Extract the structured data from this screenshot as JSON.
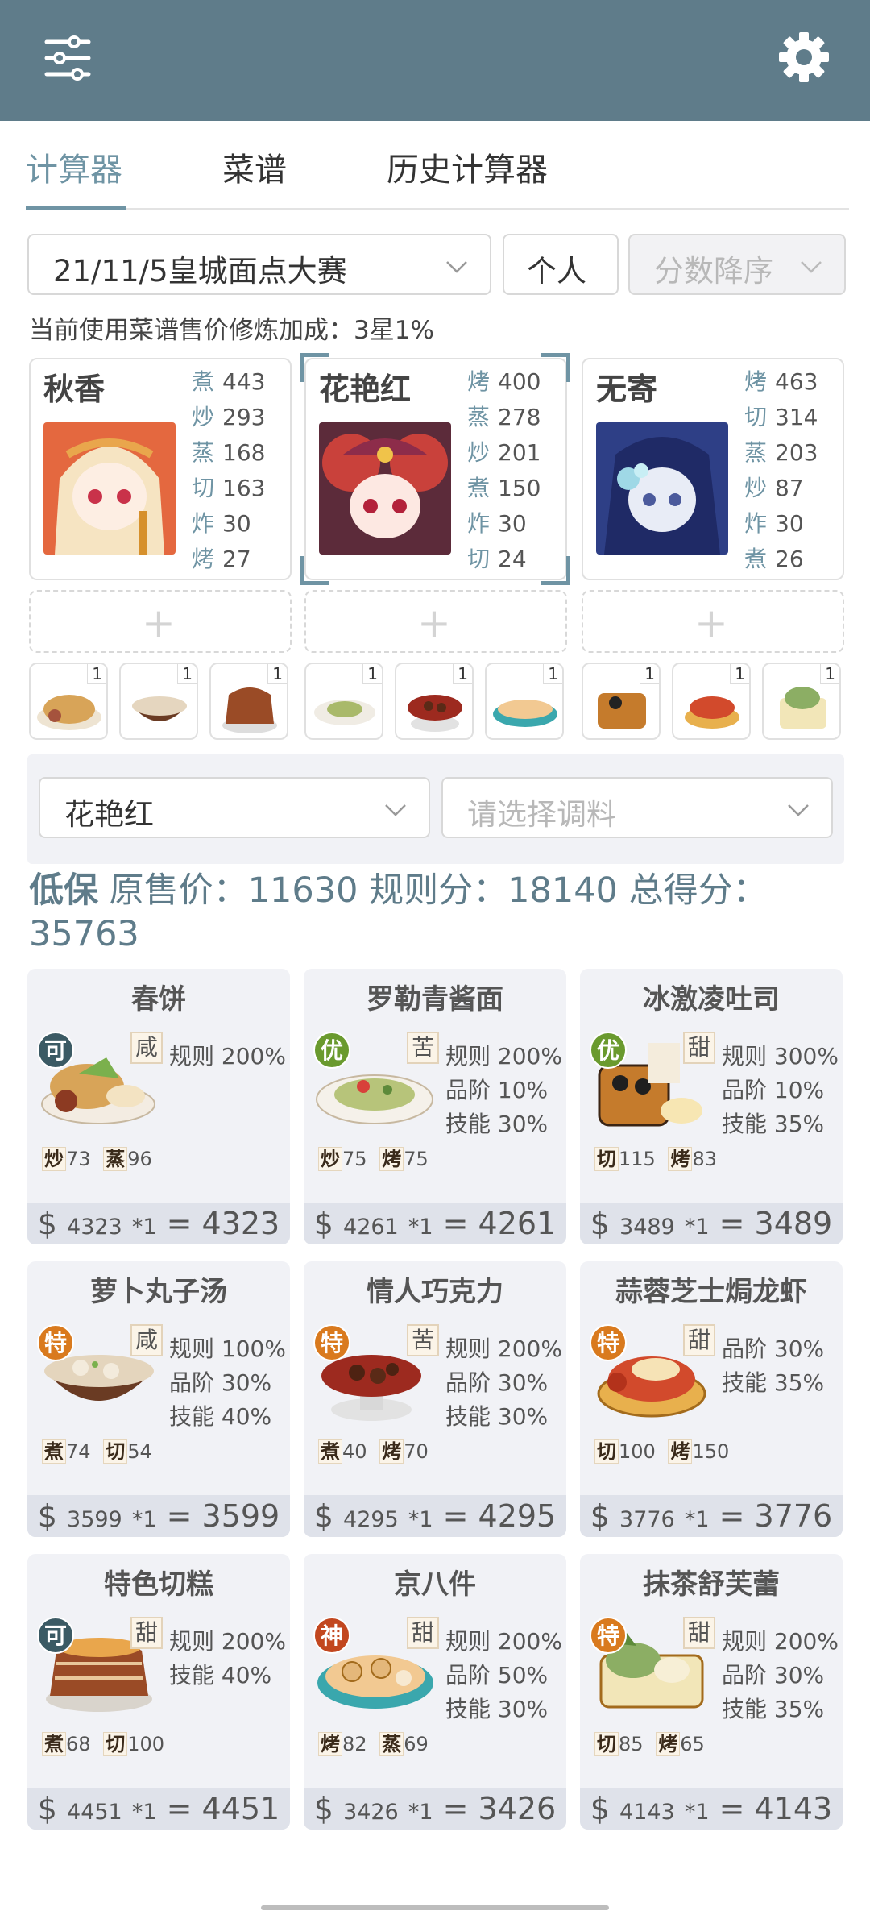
{
  "appbar": {
    "menu_icon": "sliders-icon",
    "settings_icon": "gear-icon",
    "color": "#5f7c8a"
  },
  "tabs": [
    {
      "label": "计算器",
      "active": true
    },
    {
      "label": "菜谱"
    },
    {
      "label": "历史计算器"
    }
  ],
  "filters": {
    "event": "21/11/5皇城面点大赛",
    "mode": "个人",
    "sort_placeholder": "分数降序"
  },
  "note": "当前使用菜谱售价修炼加成：3星1%",
  "chefs": [
    {
      "name": "秋香",
      "stats": [
        [
          "煮",
          "443"
        ],
        [
          "炒",
          "293"
        ],
        [
          "蒸",
          "168"
        ],
        [
          "切",
          "163"
        ],
        [
          "炸",
          "30"
        ],
        [
          "烤",
          "27"
        ]
      ]
    },
    {
      "name": "花艳红",
      "selected": true,
      "stats": [
        [
          "烤",
          "400"
        ],
        [
          "蒸",
          "278"
        ],
        [
          "炒",
          "201"
        ],
        [
          "煮",
          "150"
        ],
        [
          "炸",
          "30"
        ],
        [
          "切",
          "24"
        ]
      ]
    },
    {
      "name": "无寄",
      "stats": [
        [
          "烤",
          "463"
        ],
        [
          "切",
          "314"
        ],
        [
          "蒸",
          "203"
        ],
        [
          "炒",
          "87"
        ],
        [
          "炸",
          "30"
        ],
        [
          "煮",
          "26"
        ]
      ]
    }
  ],
  "add_label": "+",
  "dish_slot_count": "1",
  "chef_select": "花艳红",
  "seasoning_placeholder": "请选择调料",
  "summary": {
    "low": "低保",
    "text": " 原售价：11630 规则分：18140 总得分：",
    "total": "35763"
  },
  "dishes": [
    {
      "name": "春饼",
      "grade": "可",
      "grade_color": "#3b5a64",
      "taste": "咸",
      "rules": [
        "规则 200%"
      ],
      "skills": [
        [
          "炒",
          "73"
        ],
        [
          "蒸",
          "96"
        ]
      ],
      "price": "4323",
      "mult": "*1",
      "total": "4323"
    },
    {
      "name": "罗勒青酱面",
      "grade": "优",
      "grade_color": "#6a9a2e",
      "taste": "苦",
      "rules": [
        "规则 200%",
        "品阶 10%",
        "技能 30%"
      ],
      "skills": [
        [
          "炒",
          "75"
        ],
        [
          "烤",
          "75"
        ]
      ],
      "price": "4261",
      "mult": "*1",
      "total": "4261"
    },
    {
      "name": "冰激凌吐司",
      "grade": "优",
      "grade_color": "#6a9a2e",
      "taste": "甜",
      "rules": [
        "规则 300%",
        "品阶 10%",
        "技能 35%"
      ],
      "skills": [
        [
          "切",
          "115"
        ],
        [
          "烤",
          "83"
        ]
      ],
      "price": "3489",
      "mult": "*1",
      "total": "3489"
    },
    {
      "name": "萝卜丸子汤",
      "grade": "特",
      "grade_color": "#d97a1e",
      "taste": "咸",
      "rules": [
        "规则 100%",
        "品阶 30%",
        "技能 40%"
      ],
      "skills": [
        [
          "煮",
          "74"
        ],
        [
          "切",
          "54"
        ]
      ],
      "price": "3599",
      "mult": "*1",
      "total": "3599"
    },
    {
      "name": "情人巧克力",
      "grade": "特",
      "grade_color": "#d97a1e",
      "taste": "苦",
      "rules": [
        "规则 200%",
        "品阶 30%",
        "技能 30%"
      ],
      "skills": [
        [
          "煮",
          "40"
        ],
        [
          "烤",
          "70"
        ]
      ],
      "price": "4295",
      "mult": "*1",
      "total": "4295"
    },
    {
      "name": "蒜蓉芝士焗龙虾",
      "grade": "特",
      "grade_color": "#d97a1e",
      "taste": "甜",
      "rules": [
        "品阶 30%",
        "技能 35%"
      ],
      "skills": [
        [
          "切",
          "100"
        ],
        [
          "烤",
          "150"
        ]
      ],
      "price": "3776",
      "mult": "*1",
      "total": "3776"
    },
    {
      "name": "特色切糕",
      "grade": "可",
      "grade_color": "#3b5a64",
      "taste": "甜",
      "rules": [
        "规则 200%",
        "技能 40%"
      ],
      "skills": [
        [
          "煮",
          "68"
        ],
        [
          "切",
          "100"
        ]
      ],
      "price": "4451",
      "mult": "*1",
      "total": "4451"
    },
    {
      "name": "京八件",
      "grade": "神",
      "grade_color": "#c2471f",
      "taste": "甜",
      "rules": [
        "规则 200%",
        "品阶 50%",
        "技能 30%"
      ],
      "skills": [
        [
          "烤",
          "82"
        ],
        [
          "蒸",
          "69"
        ]
      ],
      "price": "3426",
      "mult": "*1",
      "total": "3426"
    },
    {
      "name": "抹茶舒芙蕾",
      "grade": "特",
      "grade_color": "#d97a1e",
      "taste": "甜",
      "rules": [
        "规则 200%",
        "品阶 30%",
        "技能 35%"
      ],
      "skills": [
        [
          "切",
          "85"
        ],
        [
          "烤",
          "65"
        ]
      ],
      "price": "4143",
      "mult": "*1",
      "total": "4143"
    }
  ]
}
